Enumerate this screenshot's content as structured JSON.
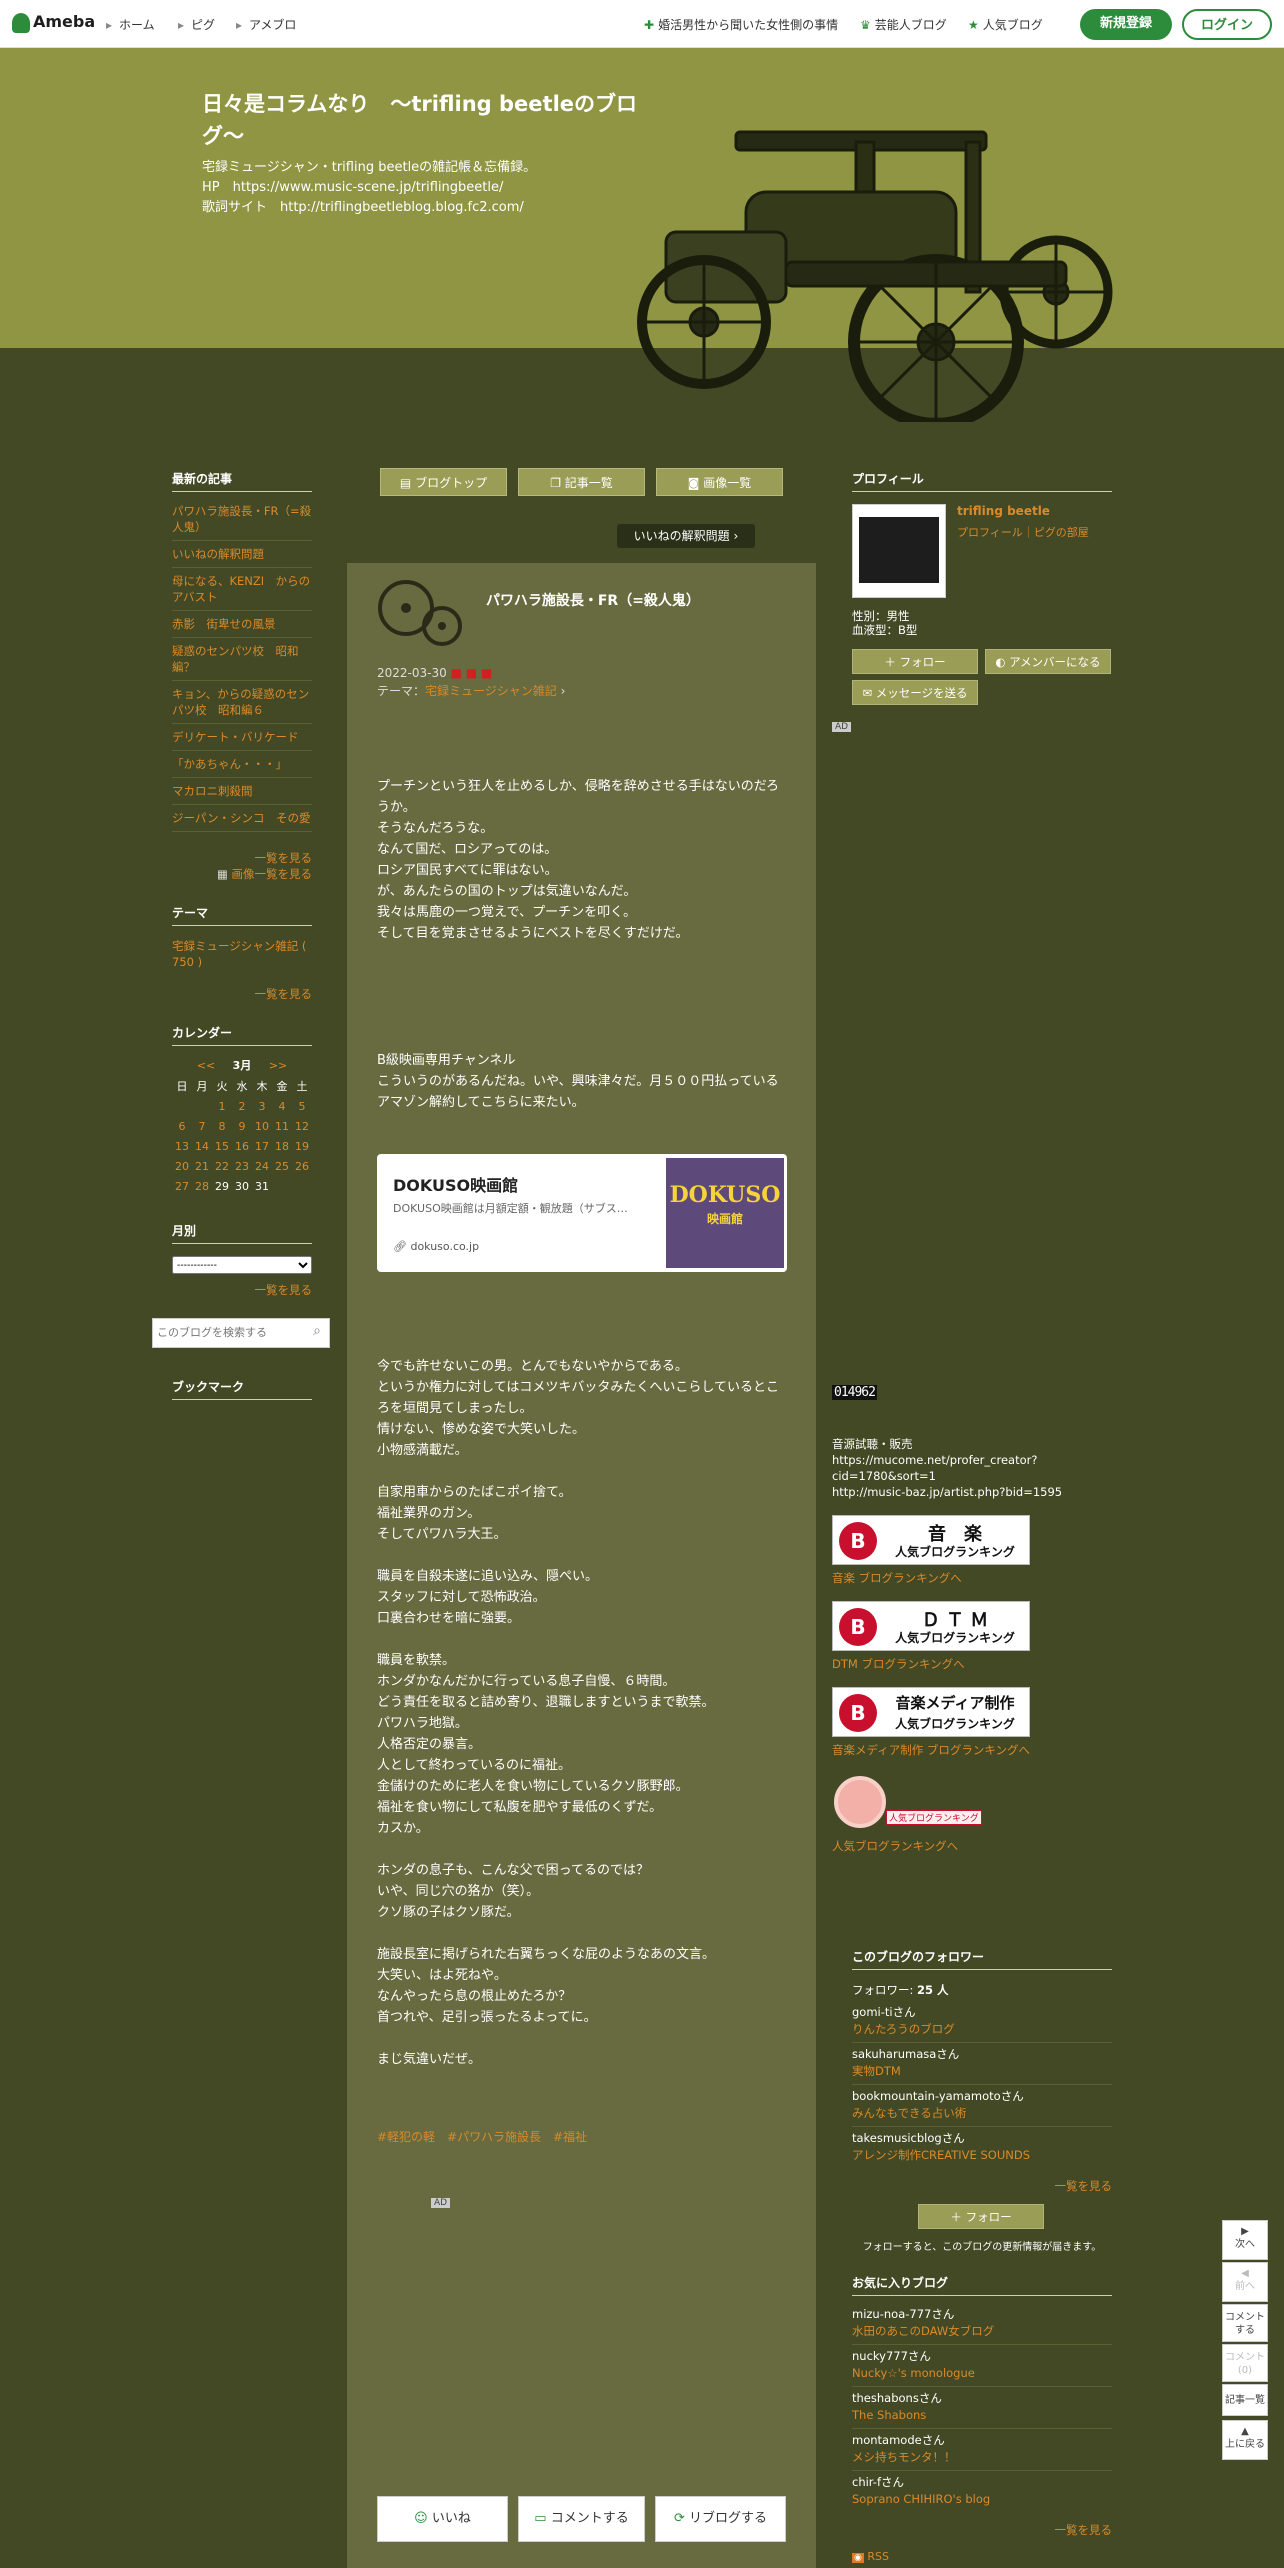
{
  "topbar": {
    "logo": "Ameba",
    "nav": [
      "ホーム",
      "ピグ",
      "アメブロ"
    ],
    "right_links": [
      "婚活男性から聞いた女性側の事情",
      "芸能人ブログ",
      "人気ブログ"
    ],
    "signup": "新規登録",
    "login": "ログイン"
  },
  "header": {
    "title": "日々是コラムなり　～trifling beetleのブログ～",
    "description": "宅録ミュージシャン・trifling beetleの雑記帳＆忘備録。\nHP　https://www.music-scene.jp/triflingbeetle/\n歌詞サイト　http://triflingbeetleblog.blog.fc2.com/"
  },
  "left": {
    "recent_heading": "最新の記事",
    "recent": [
      "パワハラ施設長・FR（=殺人鬼）",
      "いいねの解釈問題",
      "母になる、KENZI　からのアバスト",
      "赤影　街卑せの風景",
      "疑惑のセンパツ校　昭和編？",
      "キョン、からの疑惑のセンパツ校　昭和編６",
      "デリケート・バリケード",
      "「かあちゃん・・・」",
      "マカロニ刺殺間",
      "ジーパン・シンコ　その愛"
    ],
    "more": "一覧を見る",
    "image_list": "画像一覧を見る",
    "theme_heading": "テーマ",
    "theme_item": "宅録ミュージシャン雑記 ( 750 )",
    "calendar_heading": "カレンダー",
    "calendar_prev": "<<",
    "calendar_month": "3月",
    "calendar_next": ">>",
    "weekdays": [
      "日",
      "月",
      "火",
      "水",
      "木",
      "金",
      "土"
    ],
    "month_heading": "月別",
    "month_select": "------------",
    "search_placeholder": "このブログを検索する",
    "bookmark_heading": "ブックマーク"
  },
  "calendar_weeks": [
    [
      "",
      "",
      "1",
      "2",
      "3",
      "4",
      "5"
    ],
    [
      "6",
      "7",
      "8",
      "9",
      "10",
      "11",
      "12"
    ],
    [
      "13",
      "14",
      "15",
      "16",
      "17",
      "18",
      "19"
    ],
    [
      "20",
      "21",
      "22",
      "23",
      "24",
      "25",
      "26"
    ],
    [
      "27",
      "28",
      "29",
      "30",
      "31",
      "",
      ""
    ]
  ],
  "main": {
    "tabs": [
      "ブログトップ",
      "記事一覧",
      "画像一覧"
    ],
    "prev_article": "いいねの解釈問題",
    "article_title": "パワハラ施設長・FR（=殺人鬼）",
    "date": "2022-03-30",
    "theme_label": "テーマ：",
    "theme": "宅録ミュージシャン雑記",
    "para1": "プーチンという狂人を止めるしか、侵略を辞めさせる手はないのだろうか。\nそうなんだろうな。\nなんて国だ、ロシアってのは。\nロシア国民すべてに罪はない。\nが、あんたらの国のトップは気違いなんだ。\n我々は馬鹿の一つ覚えで、プーチンを叩く。\nそして目を覚まさせるようにベストを尽くすだけだ。",
    "para2": "B級映画専用チャンネル\nこういうのがあるんだね。いや、興味津々だ。月５００円払っているアマゾン解約してこちらに来たい。",
    "card_title": "DOKUSO映画館",
    "card_desc": "DOKUSO映画館は月額定額・観放題（サブス…",
    "card_domain": "dokuso.co.jp",
    "card_thumb_text": "DOKUSO",
    "card_thumb_sub": "映画館",
    "para3": "今でも許せないこの男。とんでもないやからである。\nというか権力に対してはコメツキバッタみたくへいこらしているところを垣間見てしまったし。\n情けない、惨めな姿で大笑いした。\n小物感満載だ。\n\n自家用車からのたばこポイ捨て。\n福祉業界のガン。\nそしてパワハラ大王。\n\n職員を自殺未遂に追い込み、隠ぺい。\nスタッフに対して恐怖政治。\n口裏合わせを暗に強要。\n\n職員を軟禁。\nホンダかなんだかに行っている息子自慢、６時間。\nどう責任を取ると詰め寄り、退職しますというまで軟禁。\nパワハラ地獄。\n人格否定の暴言。\n人として終わっているのに福祉。\n金儲けのために老人を食い物にしているクソ豚野郎。\n福祉を食い物にして私腹を肥やす最低のくずだ。\nカスか。\n\nホンダの息子も、こんな父で困ってるのでは？\nいや、同じ穴の狢か（笑）。\nクソ豚の子はクソ豚だ。\n\n施設長室に掲げられた右翼ちっくな屁のようなあの文言。\n大笑い、はよ死ねや。\nなんやったら息の根止めたろか？\n首つれや、足引っ張ったるよってに。\n\nまじ気違いだぜ。",
    "hashtags": "#軽犯の軽　#パワハラ施設長　#福祉",
    "ad": "AD",
    "like": "いいね",
    "comment": "コメントする",
    "reblog": "リブログする"
  },
  "right": {
    "profile_heading": "プロフィール",
    "profile_name": "trifling beetle",
    "profile_links": "プロフィール｜ピグの部屋",
    "gender": "性別：男性",
    "blood": "血液型：B型",
    "follow_btn": "フォロー",
    "amember_btn": "アメンバーになる",
    "message_btn": "メッセージを送る",
    "ad": "AD",
    "counter": "014962",
    "sales_text": "音源試聴・販売\nhttps://mucome.net/profer_creator?cid=1780&sort=1\nhttp://music-baz.jp/artist.php?bid=1595",
    "rankings": [
      {
        "title": "音　楽",
        "sub": "人気ブログランキング",
        "link": "音楽 ブログランキングへ"
      },
      {
        "title": "Ｄ Ｔ Ｍ",
        "sub": "人気ブログランキング",
        "link": "DTM ブログランキングへ"
      },
      {
        "title": "音楽メディア制作",
        "sub": "人気ブログランキング",
        "link": "音楽メディア制作 ブログランキングへ"
      }
    ],
    "popular_link": "人気ブログランキングへ",
    "popular_badge": "人気ブログランキング",
    "followers_heading": "このブログのフォロワー",
    "followers_label": "フォロワー:",
    "followers_count": "25 人",
    "followers": [
      {
        "user": "gomi-tiさん",
        "blog": "りんたろうのブログ"
      },
      {
        "user": "sakuharumasaさん",
        "blog": "実物DTM"
      },
      {
        "user": "bookmountain-yamamotoさん",
        "blog": "みんなもできる占い術"
      },
      {
        "user": "takesmusicblogさん",
        "blog": "アレンジ制作CREATIVE SOUNDS"
      }
    ],
    "more": "一覧を見る",
    "follow_btn2": "フォロー",
    "follow_note": "フォローすると、このブログの更新情報が届きます。",
    "fav_heading": "お気に入りブログ",
    "favorites": [
      {
        "user": "mizu-noa-777さん",
        "blog": "水田のあこのDAW女ブログ"
      },
      {
        "user": "nucky777さん",
        "blog": "Nucky☆'s monologue"
      },
      {
        "user": "theshabonsさん",
        "blog": "The Shabons"
      },
      {
        "user": "montamodeさん",
        "blog": "メシ持ちモンタ！！"
      },
      {
        "user": "chir-fさん",
        "blog": "Soprano CHIHIRO's blog"
      }
    ],
    "more2": "一覧を見る",
    "rss": "RSS"
  },
  "floating": {
    "next": "次へ",
    "prev": "前へ",
    "comment": "コメントする",
    "comment_count": "コメント(0)",
    "list": "記事一覧",
    "top": "上に戻る"
  }
}
